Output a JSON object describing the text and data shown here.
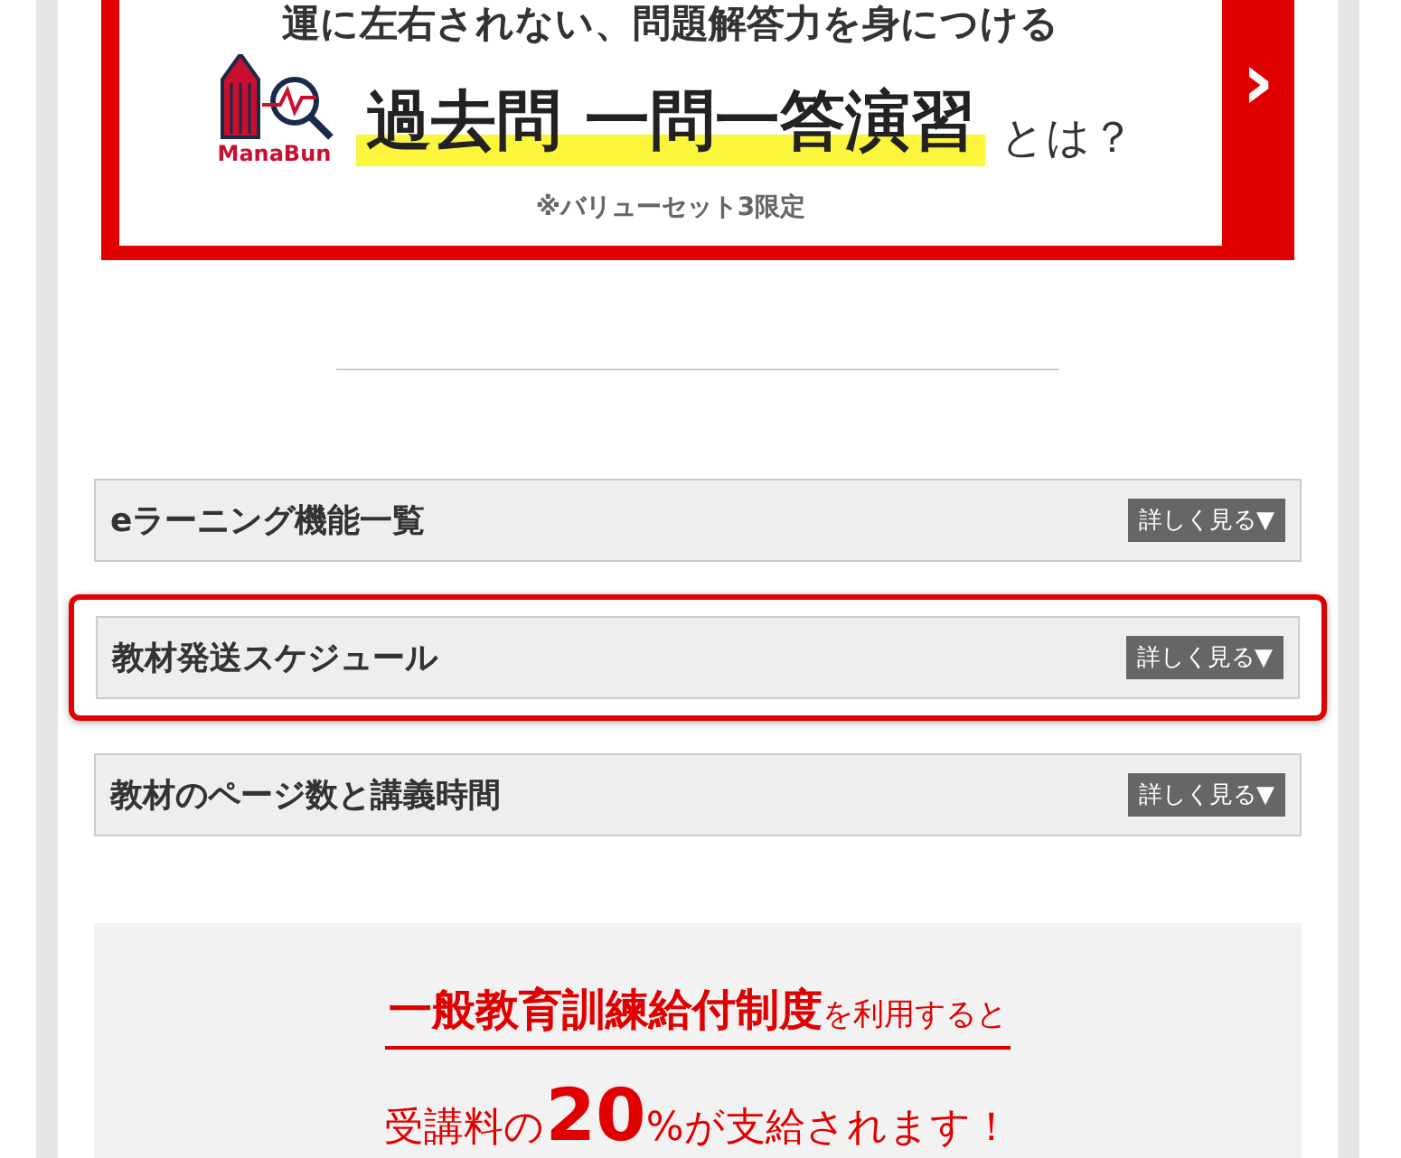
{
  "banner": {
    "headline": "運に左右されない、問題解答力を身につける",
    "logo_text": "ManaBun",
    "title": "過去問 一問一答演習",
    "title_suffix": "とは？",
    "note": "※バリューセット3限定",
    "arrow": "›"
  },
  "accordions": [
    {
      "title": "eラーニング機能一覧",
      "button": "詳しく見る▼",
      "highlighted": false
    },
    {
      "title": "教材発送スケジュール",
      "button": "詳しく見る▼",
      "highlighted": true
    },
    {
      "title": "教材のページ数と講義時間",
      "button": "詳しく見る▼",
      "highlighted": false
    }
  ],
  "benefit": {
    "highlight": "一般教育訓練給付制度",
    "rest": "を利用すると",
    "line2_before": "受講料の",
    "number": "20",
    "line2_unit": "%",
    "line2_after": "が支給されます！"
  }
}
